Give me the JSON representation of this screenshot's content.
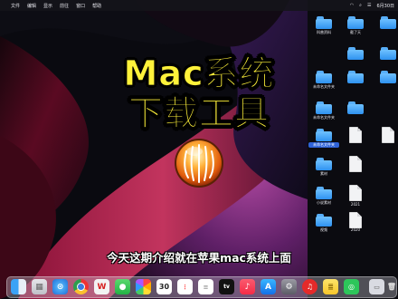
{
  "menubar": {
    "apple_glyph": "",
    "items": [
      "文件",
      "编辑",
      "显示",
      "前往",
      "窗口",
      "帮助"
    ],
    "time": "6月30日"
  },
  "title": {
    "line1": "Mac系统",
    "line2": "下载工具"
  },
  "subtitle": "今天这期介绍就在苹果mac系统上面",
  "desktop_icons": [
    {
      "label": "科普资料",
      "type": "folder"
    },
    {
      "label": "截了天",
      "type": "folder"
    },
    {
      "label": "未命名文件夹",
      "type": "folder"
    },
    {
      "label": "未命名文件夹",
      "type": "folder"
    },
    {
      "label": "未命名文件夹",
      "type": "folder"
    },
    {
      "label": "素材",
      "type": "folder"
    },
    {
      "label": "小说素材",
      "type": "folder"
    },
    {
      "label": "2021",
      "type": "file"
    },
    {
      "label": "视频",
      "type": "folder"
    },
    {
      "label": "2020",
      "type": "file"
    }
  ],
  "dock": {
    "apps": [
      {
        "name": "finder"
      },
      {
        "name": "launchpad"
      },
      {
        "name": "safari"
      },
      {
        "name": "chrome"
      },
      {
        "name": "wps"
      },
      {
        "name": "messages"
      },
      {
        "name": "photos"
      },
      {
        "name": "calendar",
        "label": "30"
      },
      {
        "name": "reminders"
      },
      {
        "name": "apple-tv",
        "label": "tv"
      },
      {
        "name": "music"
      },
      {
        "name": "app-store"
      },
      {
        "name": "system-preferences"
      },
      {
        "name": "netease-music"
      },
      {
        "name": "notes"
      },
      {
        "name": "wechat"
      },
      {
        "name": "finder-window"
      },
      {
        "name": "trash"
      }
    ]
  },
  "colors": {
    "title_yellow": "#fff23a",
    "wallpaper_red": "#8a1238",
    "wallpaper_purple": "#5a2b7a"
  }
}
